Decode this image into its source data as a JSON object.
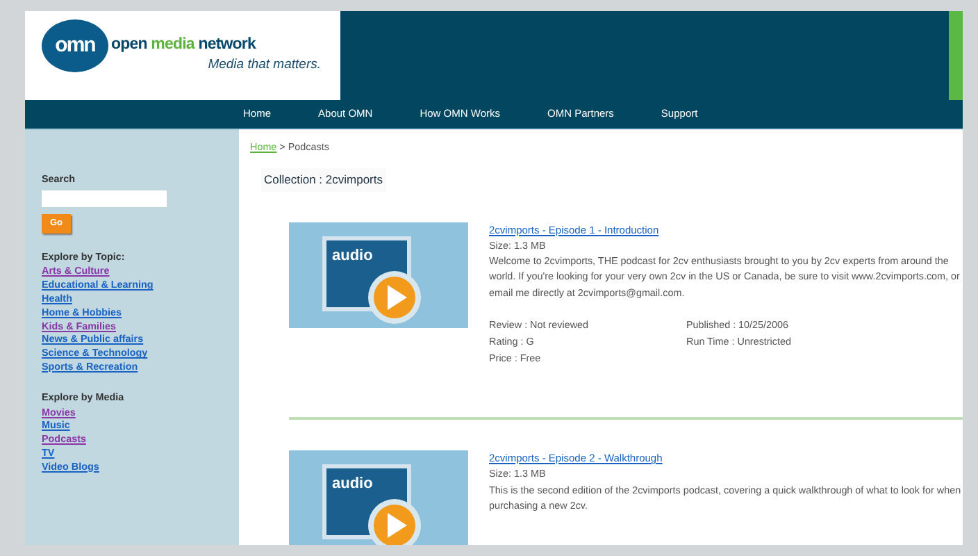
{
  "logo": {
    "mark": "omn",
    "name_parts": [
      {
        "text": "open ",
        "accent": false
      },
      {
        "text": "media",
        "accent": true
      },
      {
        "text": " network",
        "accent": false
      }
    ],
    "tagline": "Media that matters."
  },
  "nav": [
    "Home",
    "About OMN",
    "How OMN Works",
    "OMN Partners",
    "Support"
  ],
  "sidebar": {
    "search_label": "Search",
    "go_button": "Go",
    "sections": [
      {
        "heading": "Explore by Topic:",
        "links": [
          {
            "label": "Arts & Culture",
            "visited": true
          },
          {
            "label": "Educational & Learning",
            "visited": false
          },
          {
            "label": "Health",
            "visited": false
          },
          {
            "label": "Home & Hobbies",
            "visited": false
          },
          {
            "label": "Kids & Families",
            "visited": true
          },
          {
            "label": "News & Public affairs",
            "visited": false
          },
          {
            "label": "Science & Technology",
            "visited": false
          },
          {
            "label": "Sports & Recreation",
            "visited": false
          }
        ]
      },
      {
        "heading": "Explore by Media",
        "links": [
          {
            "label": "Movies",
            "visited": true
          },
          {
            "label": "Music",
            "visited": false
          },
          {
            "label": "Podcasts",
            "visited": true
          },
          {
            "label": "TV",
            "visited": false
          },
          {
            "label": "Video Blogs",
            "visited": false
          }
        ]
      }
    ]
  },
  "breadcrumb": {
    "link": "Home",
    "current": " > Podcasts"
  },
  "collection": "Collection : 2cvimports",
  "episodes": [
    {
      "thumbnail_label": "audio",
      "title": "2cvimports - Episode 1 - Introduction",
      "size": "Size: 1.3 MB",
      "description": "Welcome to 2cvimports, THE podcast for 2cv enthusiasts brought to you by 2cv experts from around the world. If you're looking for your very own 2cv in the US or Canada, be sure to visit www.2cvimports.com, or email me directly at 2cvimports@gmail.com.",
      "meta_left": [
        "Review : Not reviewed",
        "Rating : G",
        "Price : Free"
      ],
      "meta_right": [
        "Published : 10/25/2006",
        "Run Time : Unrestricted"
      ]
    },
    {
      "thumbnail_label": "audio",
      "title": "2cvimports - Episode 2 - Walkthrough",
      "size": "Size: 1.3 MB",
      "description": "This is the second edition of the 2cvimports podcast, covering a quick walkthrough of what to look for when purchasing a new 2cv."
    }
  ]
}
